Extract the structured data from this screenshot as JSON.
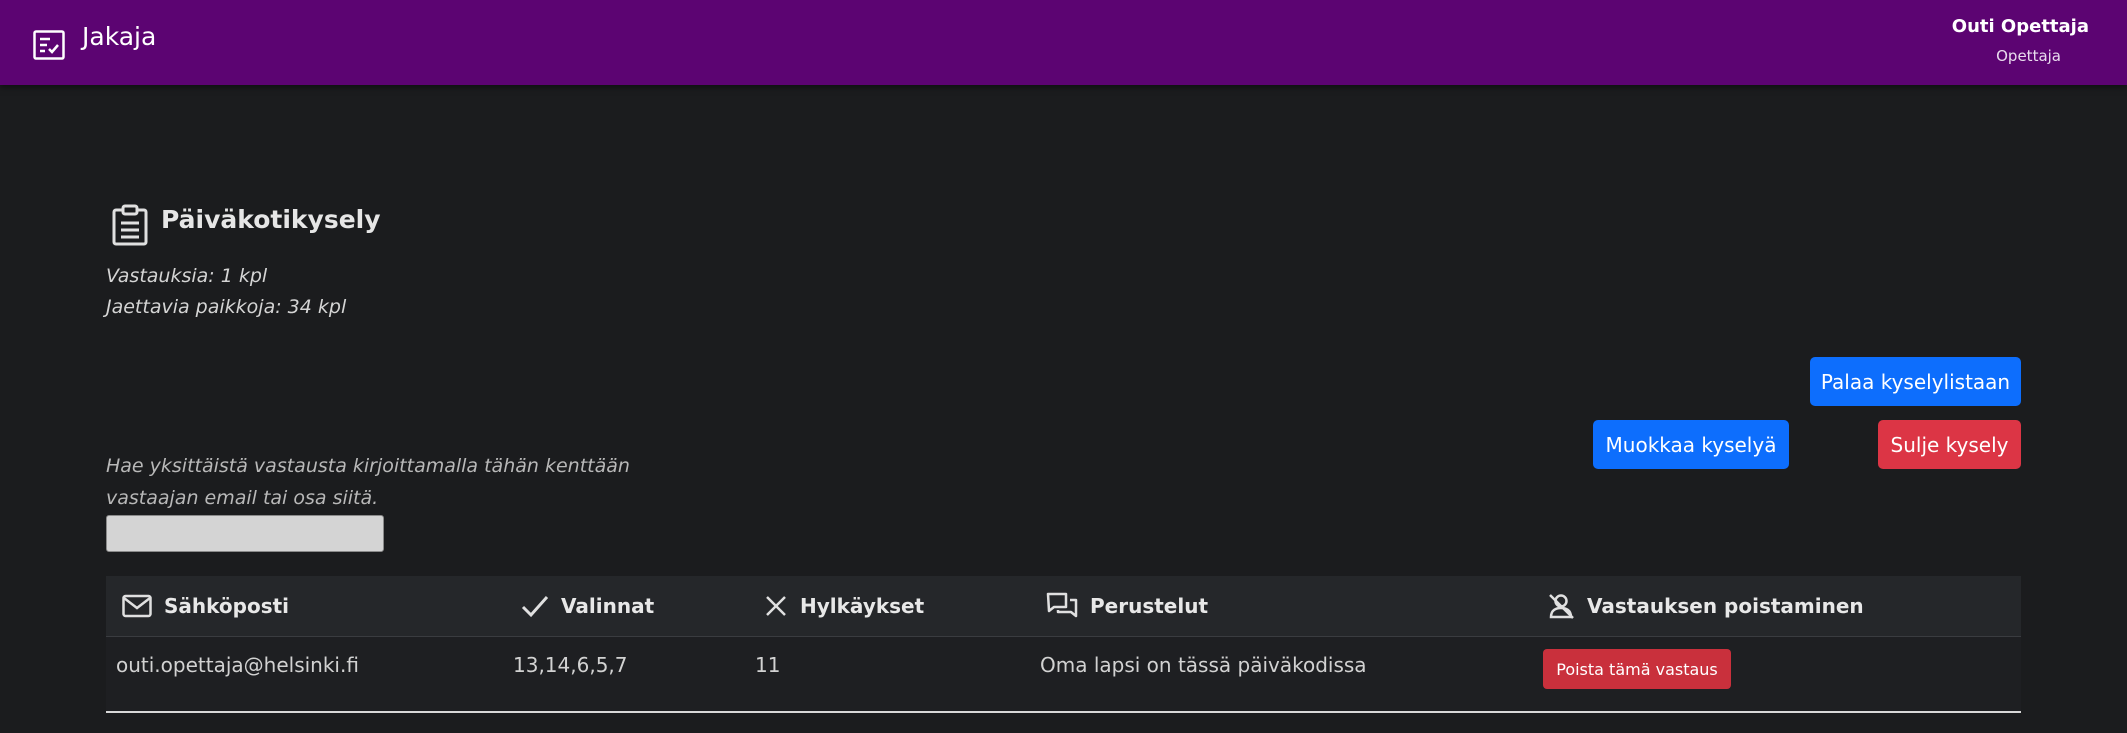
{
  "header": {
    "app_title": "Jakaja",
    "user_name": "Outi Opettaja",
    "user_role": "Opettaja",
    "background_color": "#5c0472",
    "app_icon": "checklist-icon"
  },
  "survey": {
    "title": "Päiväkotikysely",
    "icon": "clipboard-icon",
    "responses": "Vastauksia: 1 kpl",
    "places": "Jaettavia paikkoja: 34 kpl"
  },
  "actions": {
    "back_label": "Palaa kyselylistaan",
    "edit_label": "Muokkaa kyselyä",
    "close_label": "Sulje kysely",
    "primary_color": "#0d6efd",
    "danger_color": "#dc3545"
  },
  "search": {
    "hint_line1": "Hae yksittäistä vastausta kirjoittamalla tähän kenttään",
    "hint_line2": "vastaajan email tai osa siitä.",
    "value": ""
  },
  "table": {
    "columns": [
      {
        "label": "Sähköposti",
        "icon": "envelope-icon"
      },
      {
        "label": "Valinnat",
        "icon": "checkmark-icon"
      },
      {
        "label": "Hylkäykset",
        "icon": "x-icon"
      },
      {
        "label": "Perustelut",
        "icon": "chat-icon"
      },
      {
        "label": "Vastauksen poistaminen",
        "icon": "person-off-icon"
      }
    ],
    "rows": [
      {
        "email": "outi.opettaja@helsinki.fi",
        "choices": "13,14,6,5,7",
        "rejections": "11",
        "reasons": "Oma lapsi on tässä päiväkodissa",
        "delete_label": "Poista tämä vastaus"
      }
    ]
  }
}
